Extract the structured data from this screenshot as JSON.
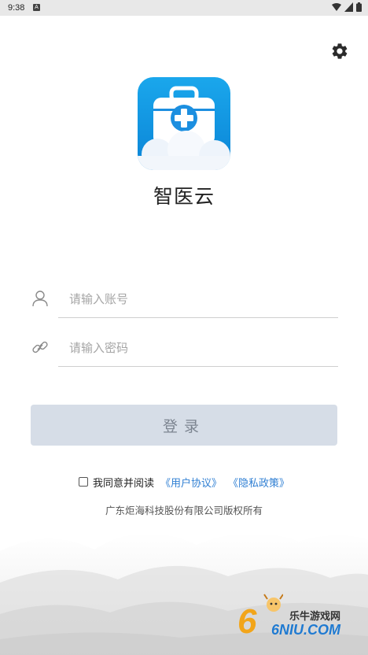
{
  "status_bar": {
    "time": "9:38",
    "notification_glyph": "A"
  },
  "app": {
    "name": "智医云"
  },
  "icons": {
    "settings": "gear-icon",
    "account": "user-icon",
    "password": "link-icon"
  },
  "form": {
    "account_placeholder": "请输入账号",
    "password_placeholder": "请输入密码",
    "login_label": "登录"
  },
  "agreement": {
    "prefix": "我同意并阅读",
    "user_agreement": "《用户协议》",
    "privacy_policy": "《隐私政策》",
    "checked": false
  },
  "footer": {
    "copyright": "广东炬海科技股份有限公司版权所有"
  },
  "watermark": {
    "site_name": "乐牛游戏网",
    "domain": "6NIU.COM"
  },
  "colors": {
    "brand": "#1aa7ec",
    "link": "#2f7fd3",
    "login_button_bg": "#d6dde7",
    "login_button_text": "#7c8490"
  }
}
